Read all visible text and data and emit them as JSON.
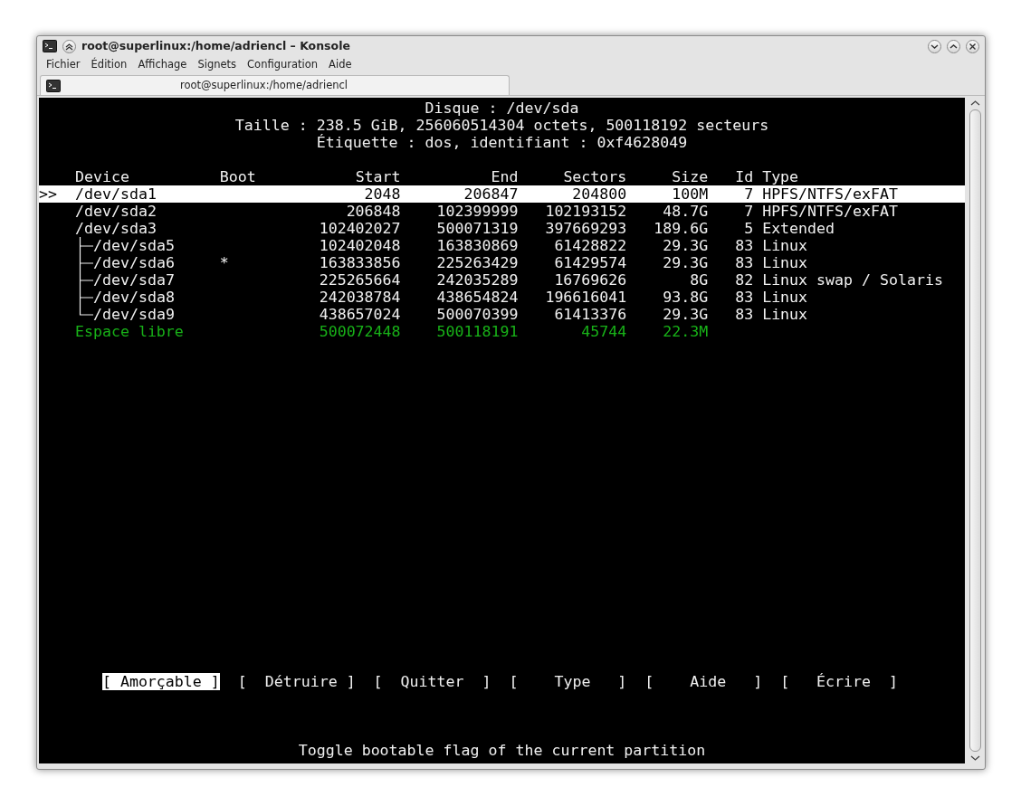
{
  "window": {
    "title": "root@superlinux:/home/adriencl – Konsole"
  },
  "menu": [
    "Fichier",
    "Édition",
    "Affichage",
    "Signets",
    "Configuration",
    "Aide"
  ],
  "tabs": [
    {
      "label": "root@superlinux:/home/adriencl",
      "selected": true
    }
  ],
  "disk_info": [
    "Disque : /dev/sda",
    "Taille : 238.5 GiB, 256060514304 octets, 500118192 secteurs",
    "Étiquette : dos, identifiant : 0xf4628049"
  ],
  "table": {
    "cursor_marker": ">>",
    "columns": [
      "Device",
      "Boot",
      "Start",
      "End",
      "Sectors",
      "Size",
      "Id",
      "Type"
    ],
    "rows": [
      {
        "kind": "partition",
        "selected": true,
        "device": "/dev/sda1",
        "start": "2048",
        "end": "206847",
        "sectors": "204800",
        "size": "100M",
        "id": "7",
        "type": "HPFS/NTFS/exFAT"
      },
      {
        "kind": "partition",
        "selected": false,
        "device": "/dev/sda2",
        "start": "206848",
        "end": "102399999",
        "sectors": "102193152",
        "size": "48.7G",
        "id": "7",
        "type": "HPFS/NTFS/exFAT"
      },
      {
        "kind": "partition",
        "selected": false,
        "device": "/dev/sda3",
        "start": "102402027",
        "end": "500071319",
        "sectors": "397669293",
        "size": "189.6G",
        "id": "5",
        "type": "Extended",
        "children": [
          {
            "kind": "partition",
            "selected": false,
            "device": "/dev/sda5",
            "start": "102402048",
            "end": "163830869",
            "sectors": "61428822",
            "size": "29.3G",
            "id": "83",
            "type": "Linux"
          },
          {
            "kind": "partition",
            "selected": false,
            "device": "/dev/sda6",
            "boot": "*",
            "start": "163833856",
            "end": "225263429",
            "sectors": "61429574",
            "size": "29.3G",
            "id": "83",
            "type": "Linux"
          },
          {
            "kind": "partition",
            "selected": false,
            "device": "/dev/sda7",
            "start": "225265664",
            "end": "242035289",
            "sectors": "16769626",
            "size": "8G",
            "id": "82",
            "type": "Linux swap / Solaris"
          },
          {
            "kind": "partition",
            "selected": false,
            "device": "/dev/sda8",
            "start": "242038784",
            "end": "438654824",
            "sectors": "196616041",
            "size": "93.8G",
            "id": "83",
            "type": "Linux"
          },
          {
            "kind": "partition",
            "selected": false,
            "device": "/dev/sda9",
            "start": "438657024",
            "end": "500070399",
            "sectors": "61413376",
            "size": "29.3G",
            "id": "83",
            "type": "Linux"
          }
        ]
      },
      {
        "kind": "free",
        "selected": false,
        "device": "Espace libre",
        "start": "500072448",
        "end": "500118191",
        "sectors": "45744",
        "size": "22.3M"
      }
    ]
  },
  "actions": [
    {
      "label": "[ Amorçable ]",
      "selected": true
    },
    {
      "label": "[  Détruire ]",
      "selected": false
    },
    {
      "label": "[  Quitter  ]",
      "selected": false
    },
    {
      "label": "[    Type   ]",
      "selected": false
    },
    {
      "label": "[    Aide   ]",
      "selected": false
    },
    {
      "label": "[   Écrire  ]",
      "selected": false
    }
  ],
  "status_line": "Toggle bootable flag of the current partition"
}
